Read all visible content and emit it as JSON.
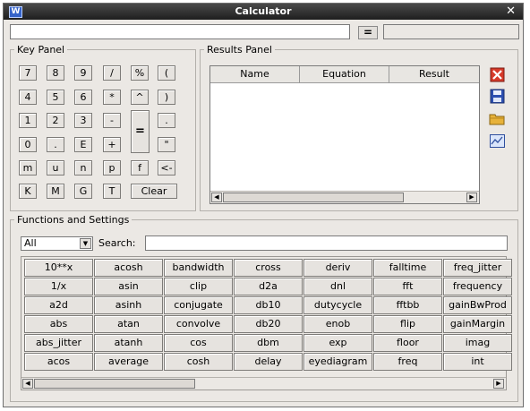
{
  "window": {
    "title": "Calculator",
    "app_icon": "W"
  },
  "expression": {
    "value": "",
    "equals_label": "=",
    "result": ""
  },
  "key_panel": {
    "legend": "Key Panel",
    "keys": [
      "7",
      "8",
      "9",
      "/",
      "%",
      "(",
      "4",
      "5",
      "6",
      "*",
      "^",
      ")",
      "1",
      "2",
      "3",
      "-",
      ".",
      "0",
      ".",
      "E",
      "+",
      "\"",
      "m",
      "u",
      "n",
      "p",
      "f",
      "<-",
      "K",
      "M",
      "G",
      "T"
    ],
    "equals_key": "=",
    "clear_label": "Clear"
  },
  "results_panel": {
    "legend": "Results Panel",
    "columns": [
      "Name",
      "Equation",
      "Result"
    ],
    "rows": [],
    "tools": [
      "delete-icon",
      "save-icon",
      "open-folder-icon",
      "plot-icon"
    ]
  },
  "functions": {
    "legend": "Functions and Settings",
    "filter_value": "All",
    "search_label": "Search:",
    "search_value": "",
    "items": [
      "10**x",
      "acosh",
      "bandwidth",
      "cross",
      "deriv",
      "falltime",
      "freq_jitter",
      "1/x",
      "asin",
      "clip",
      "d2a",
      "dnl",
      "fft",
      "frequency",
      "a2d",
      "asinh",
      "conjugate",
      "db10",
      "dutycycle",
      "fftbb",
      "gainBwProd",
      "abs",
      "atan",
      "convolve",
      "db20",
      "enob",
      "flip",
      "gainMargin",
      "abs_jitter",
      "atanh",
      "cos",
      "dbm",
      "exp",
      "floor",
      "imag",
      "acos",
      "average",
      "cosh",
      "delay",
      "eyediagram",
      "freq",
      "int"
    ]
  }
}
